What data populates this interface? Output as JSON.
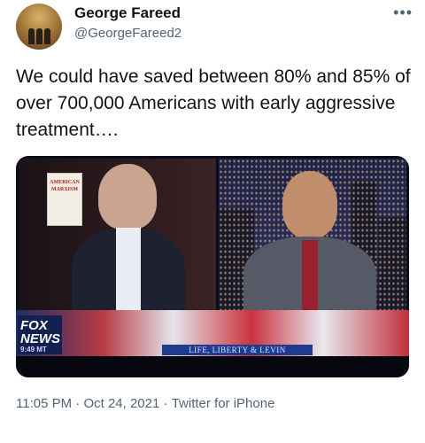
{
  "author": {
    "name": "George Fareed",
    "handle": "@GeorgeFareed2",
    "avatar_icon": "profile-photo"
  },
  "more_icon": "more-options-icon",
  "tweet_text": "We could have saved between 80% and 85% of over 700,000 Americans with early aggressive treatment….",
  "media": {
    "book_title": "AMERICAN MARXISM",
    "network_logo": "FOX NEWS",
    "clock": "9:49 MT",
    "show_banner": "LIFE, LIBERTY & LEVIN"
  },
  "meta": {
    "time": "11:05 PM",
    "date": "Oct 24, 2021",
    "separator": "·",
    "source": "Twitter for iPhone"
  },
  "colors": {
    "text": "#0f1419",
    "secondary": "#536471"
  }
}
